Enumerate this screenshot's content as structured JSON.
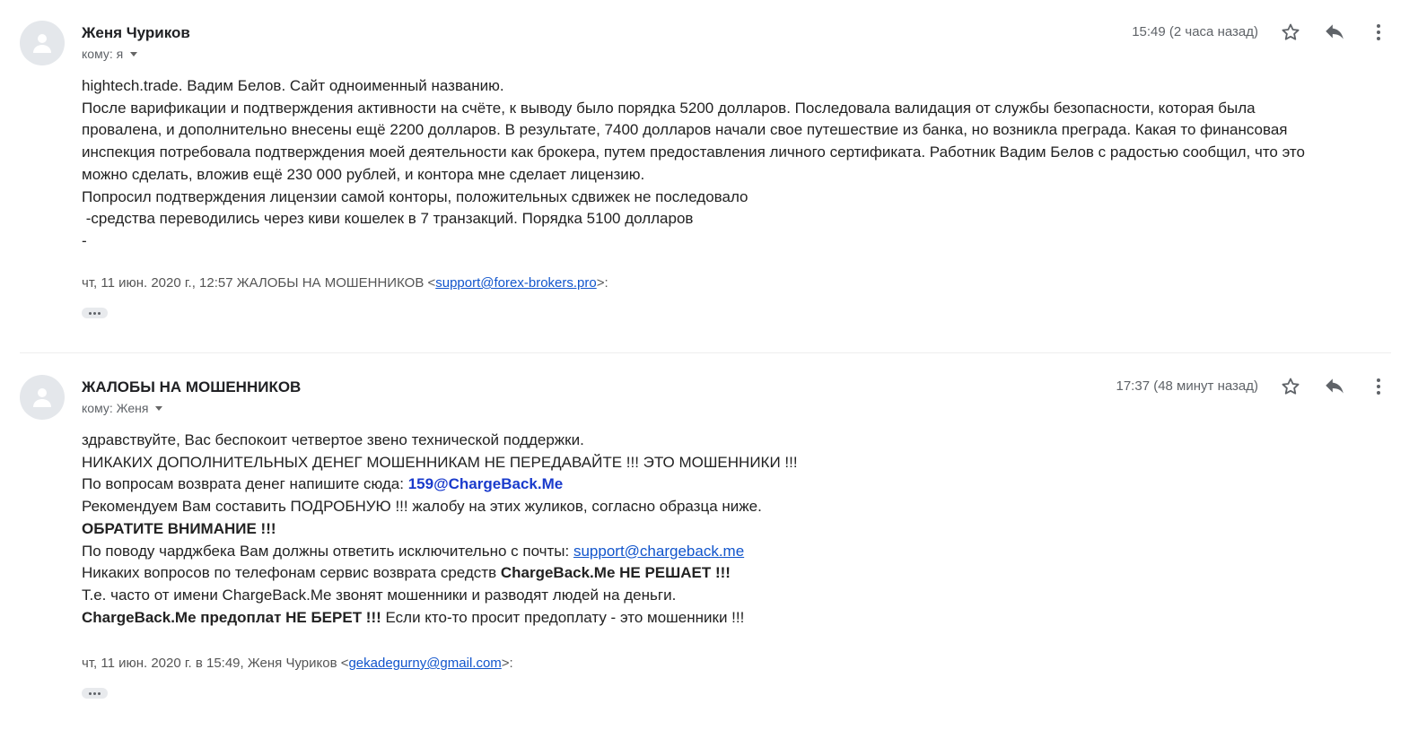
{
  "messages": [
    {
      "sender": "Женя Чуриков",
      "recipient": "кому: я",
      "time": "15:49 (2 часа назад)",
      "body_lines": [
        "hightech.trade. Вадим Белов. Сайт одноименный названию.",
        "После варификации и подтверждения активности на счёте, к выводу было порядка 5200 долларов. Последовала валидация от службы безопасности, которая была",
        "провалена, и дополнительно внесены ещё 2200 долларов. В результате, 7400 долларов начали свое путешествие из банка, но возникла преграда. Какая то финансовая",
        "инспекция потребовала подтверждения моей деятельности как брокера, путем предоставления личного сертификата. Работник Вадим Белов с радостью сообщил, что это",
        "можно сделать, вложив ещё 230 000 рублей, и контора мне сделает лицензию.",
        "Попросил подтверждения лицензии самой конторы, положительных сдвижек не последовало",
        " -средства переводились через киви кошелек в 7 транзакций. Порядка 5100 долларов",
        "-"
      ],
      "quote_prefix": "чт, 11 июн. 2020 г., 12:57 ЖАЛОБЫ НА МОШЕННИКОВ <",
      "quote_email": "support@forex-brokers.pro",
      "quote_suffix": ">:"
    },
    {
      "sender": "ЖАЛОБЫ НА МОШЕННИКОВ",
      "recipient": "кому: Женя",
      "time": "17:37 (48 минут назад)",
      "lines": {
        "l1": "здравствуйте, Вас беспокоит четвертое звено технической поддержки.",
        "l2": "НИКАКИХ ДОПОЛНИТЕЛЬНЫХ ДЕНЕГ МОШЕННИКАМ НЕ ПЕРЕДАВАЙТЕ !!! ЭТО МОШЕННИКИ !!!",
        "l3_text": "По вопросам возврата денег напишите сюда: ",
        "l3_email": "159@ChargeBack.Me",
        "l4": "Рекомендуем Вам составить ПОДРОБНУЮ !!! жалобу на этих жуликов, согласно образца ниже.",
        "l5": "ОБРАТИТЕ ВНИМАНИЕ !!!",
        "l6_text": "По поводу чарджбека Вам должны ответить исключительно с почты: ",
        "l6_email": "support@chargeback.me",
        "l7_text": "Никаких вопросов по телефонам сервис возврата средств ",
        "l7_bold": "ChargeBack.Me НЕ РЕШАЕТ !!!",
        "l8": "Т.е. часто от имени ChargeBack.Me звонят мошенники и разводят людей на деньги.",
        "l9_bold": "ChargeBack.Me предоплат НЕ БЕРЕТ !!!",
        "l9_text": " Если кто-то просит предоплату - это мошенники !!!"
      },
      "quote_prefix": "чт, 11 июн. 2020 г. в 15:49, Женя Чуриков <",
      "quote_email": "gekadegurny@gmail.com",
      "quote_suffix": ">:"
    }
  ],
  "colors": {
    "link": "#1155cc",
    "chargeback_link": "#1a3bcc",
    "avatar_bg": "#e4e7eb",
    "icon": "#5f6368"
  },
  "icons": [
    "person-icon",
    "star-icon",
    "reply-icon",
    "more-vert-icon",
    "ellipsis-icon"
  ]
}
